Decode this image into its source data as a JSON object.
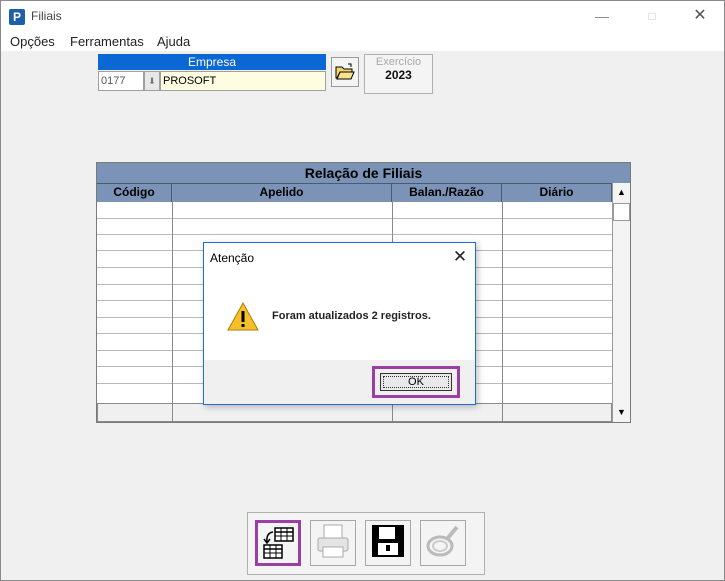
{
  "window": {
    "title": "Filiais",
    "app_icon_glyph": "P",
    "minimize_glyph": "—",
    "maximize_glyph": "□",
    "close_glyph": "✕"
  },
  "menu": {
    "items": [
      "Opções",
      "Ferramentas",
      "Ajuda"
    ]
  },
  "empresa": {
    "label": "Empresa",
    "code": "0177",
    "name": "PROSOFT",
    "dropdown_glyph": "⬇",
    "folder_icon": "folder-open-icon"
  },
  "exercicio": {
    "label": "Exercício",
    "value": "2023"
  },
  "grid": {
    "title": "Relação de Filiais",
    "columns": [
      "Código",
      "Apelido",
      "Balan./Razão",
      "Diário"
    ],
    "rows": [],
    "scroll_up_glyph": "▲",
    "scroll_down_glyph": "▼"
  },
  "dialog": {
    "title": "Atenção",
    "close_glyph": "✕",
    "message": "Foram atualizados 2 registros.",
    "ok_label": "OK",
    "icon": "warning-icon"
  },
  "toolbar": {
    "buttons": [
      "grid-refresh-icon",
      "printer-icon",
      "floppy-disk-icon",
      "search-ring-icon"
    ]
  },
  "colors": {
    "empresa_header": "#0a67d4",
    "grid_header": "#7b93b6",
    "highlight": "#9b3fa6",
    "empresa_name_bg": "#fffde1"
  }
}
